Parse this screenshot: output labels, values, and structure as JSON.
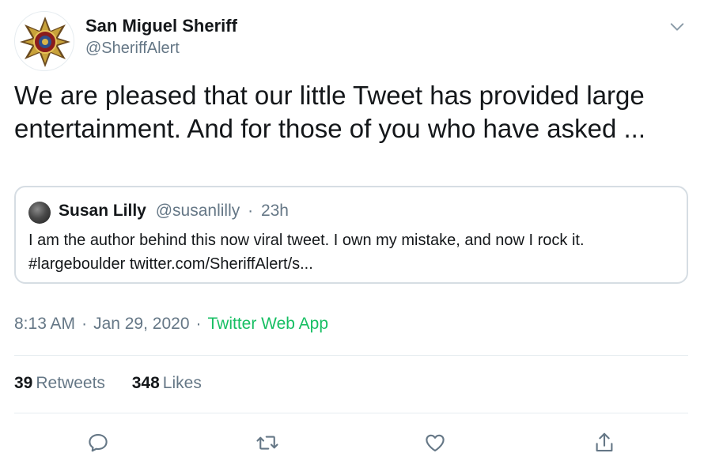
{
  "author": {
    "name": "San Miguel Sheriff",
    "handle": "@SheriffAlert",
    "avatar_icon": "sheriff-star-badge"
  },
  "tweet": {
    "text": "We are pleased that our little Tweet has provided large entertainment. And for those of you who have asked ..."
  },
  "quoted": {
    "name": "Susan Lilly",
    "handle": "@susanlilly",
    "separator": "·",
    "time": "23h",
    "text": "I am the author behind this now viral tweet. I own my mistake, and now I rock it. #largeboulder twitter.com/SheriffAlert/s..."
  },
  "meta": {
    "time": "8:13 AM",
    "sep1": "·",
    "date": "Jan 29, 2020",
    "sep2": "·",
    "source": "Twitter Web App"
  },
  "stats": {
    "retweets_count": "39",
    "retweets_label": "Retweets",
    "likes_count": "348",
    "likes_label": "Likes"
  },
  "actions": [
    "reply-icon",
    "retweet-icon",
    "like-icon",
    "share-icon"
  ],
  "colors": {
    "text": "#14171a",
    "secondary": "#657786",
    "source_green": "#17bf63",
    "border": "#e6ecf0",
    "badge_gold": "#c8a23a",
    "badge_brown": "#6b4a1f"
  }
}
